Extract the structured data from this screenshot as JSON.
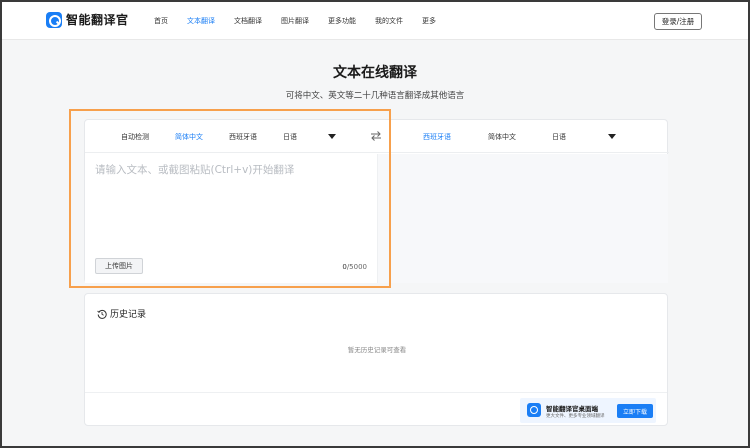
{
  "brand": {
    "name": "智能翻译官",
    "color": "#1a7ef5",
    "logo_icon": "magnifier-logo-icon"
  },
  "nav": {
    "items": [
      {
        "label": "首页",
        "active": false
      },
      {
        "label": "文本翻译",
        "active": true
      },
      {
        "label": "文档翻译",
        "active": false
      },
      {
        "label": "图片翻译",
        "active": false
      },
      {
        "label": "更多功能",
        "active": false
      },
      {
        "label": "我的文件",
        "active": false
      },
      {
        "label": "更多",
        "active": false
      }
    ],
    "login_label": "登录/注册"
  },
  "page": {
    "title": "文本在线翻译",
    "subtitle": "可将中文、英文等二十几种语言翻译成其他语言"
  },
  "translator": {
    "source_langs": [
      {
        "label": "自动检测",
        "active": false
      },
      {
        "label": "简体中文",
        "active": true
      },
      {
        "label": "西班牙语",
        "active": false
      },
      {
        "label": "日语",
        "active": false
      }
    ],
    "target_langs": [
      {
        "label": "西班牙语",
        "active": true
      },
      {
        "label": "简体中文",
        "active": false
      },
      {
        "label": "日语",
        "active": false
      }
    ],
    "swap_icon": "swap-arrows-icon",
    "input": {
      "value": "",
      "placeholder": "请输入文本、或截图粘贴(Ctrl+v)开始翻译"
    },
    "upload_label": "上传图片",
    "counter": {
      "count": "0",
      "max": "/5000"
    }
  },
  "history": {
    "icon": "clock-history-icon",
    "title": "历史记录",
    "empty_text": "暂无历史记录可查看"
  },
  "promo": {
    "title": "智能翻译官桌面端",
    "subtitle": "更大文件、更多专业领域翻译",
    "download_label": "立即下载"
  },
  "colors": {
    "accent": "#1a7ef5",
    "highlight_border": "#f7a04c"
  }
}
